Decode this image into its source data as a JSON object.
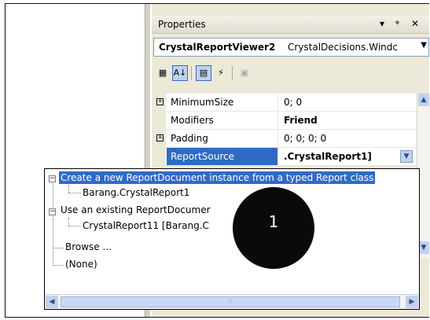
{
  "properties": {
    "title": "Properties",
    "pin_glyph": "▾ ⊤ ✕",
    "object_name": "CrystalReportViewer2",
    "object_type": "CrystalDecisions.Windc",
    "rows": [
      {
        "name": "MinimumSize",
        "value": "0; 0",
        "expandable": true
      },
      {
        "name": "Modifiers",
        "value": "Friend",
        "expandable": false
      },
      {
        "name": "Padding",
        "value": "0; 0; 0; 0",
        "expandable": true
      },
      {
        "name": "ReportSource",
        "value": ".CrystalReport1]",
        "expandable": false
      }
    ]
  },
  "popup": {
    "items": [
      {
        "label": "Create a new ReportDocument instance from a typed Report class"
      },
      {
        "label": "Barang.CrystalReport1"
      },
      {
        "label": "Use an existing ReportDocumer"
      },
      {
        "label": "CrystalReport11 [Barang.C"
      },
      {
        "label": "Browse ..."
      },
      {
        "label": "(None)"
      }
    ]
  },
  "callout": {
    "label": "1"
  }
}
